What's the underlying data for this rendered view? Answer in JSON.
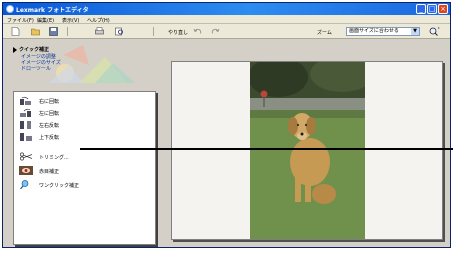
{
  "window": {
    "title": "Lexmark フォトエディタ"
  },
  "menu": [
    "ファイル(F)",
    "編集(E)",
    "表示(V)",
    "ヘルプ(H)"
  ],
  "toolbar": {
    "undo_label": "やり直し",
    "zoom_label": "ズーム",
    "zoom_value": "画面サイズに合わせる"
  },
  "quick_fix": {
    "title": "クイック補正",
    "subitems": [
      "イメージの調整",
      "イメージのサイズ",
      "ドローツール"
    ]
  },
  "actions": [
    {
      "icon": "rotate-right-icon",
      "label": "右に回転"
    },
    {
      "icon": "rotate-left-icon",
      "label": "左に回転"
    },
    {
      "icon": "flip-horizontal-icon",
      "label": "左右反転"
    },
    {
      "icon": "flip-vertical-icon",
      "label": "上下反転"
    },
    {
      "icon": "scissors-icon",
      "label": "トリミング..."
    },
    {
      "icon": "red-eye-icon",
      "label": "赤目補正"
    },
    {
      "icon": "magic-wand-icon",
      "label": "ワンクリック補正"
    }
  ],
  "colors": {
    "titlebar": "#0a58d8",
    "window_bg": "#d4d0c8",
    "canvas_bg": "#f4f3ef",
    "grass": "#6f8a4c",
    "dog": "#c79a54"
  }
}
